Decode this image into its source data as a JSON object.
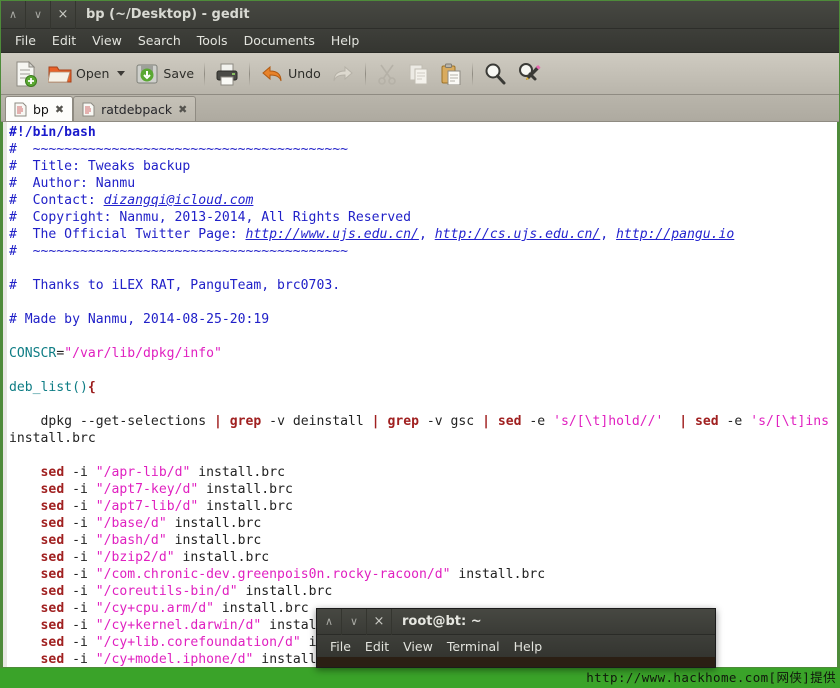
{
  "window": {
    "title": "bp (~/Desktop) - gedit",
    "controls": [
      {
        "name": "minimize",
        "glyph": "∧"
      },
      {
        "name": "maximize",
        "glyph": "∨"
      },
      {
        "name": "close",
        "glyph": "×"
      }
    ]
  },
  "menubar": {
    "items": [
      "File",
      "Edit",
      "View",
      "Search",
      "Tools",
      "Documents",
      "Help"
    ]
  },
  "toolbar": {
    "new_label": "",
    "open_label": "Open",
    "save_label": "Save",
    "print_label": "",
    "undo_label": "Undo",
    "redo_label": "",
    "cut_label": "",
    "copy_label": "",
    "paste_label": "",
    "find_label": "",
    "replace_label": ""
  },
  "tabs": [
    {
      "label": "bp",
      "active": true,
      "close": "✖"
    },
    {
      "label": "ratdebpack",
      "active": false,
      "close": "✖"
    }
  ],
  "editor": {
    "lines": [
      {
        "t": "shebang",
        "text": "#!/bin/bash"
      },
      {
        "t": "comment",
        "text": "#  ~~~~~~~~~~~~~~~~~~~~~~~~~~~~~~~~~~~~~~~~"
      },
      {
        "t": "comment",
        "text": "#  Title: Tweaks backup"
      },
      {
        "t": "comment",
        "text": "#  Author: Nanmu"
      },
      {
        "t": "comment_link",
        "pre": "#  Contact: ",
        "links": [
          "dizangqi@icloud.com"
        ],
        "seps": []
      },
      {
        "t": "comment",
        "text": "#  Copyright: Nanmu, 2013-2014, All Rights Reserved"
      },
      {
        "t": "comment_link",
        "pre": "#  The Official Twitter Page: ",
        "links": [
          "http://www.ujs.edu.cn/",
          "http://cs.ujs.edu.cn/",
          "http://pangu.io"
        ],
        "seps": [
          ", ",
          ", "
        ]
      },
      {
        "t": "comment",
        "text": "#  ~~~~~~~~~~~~~~~~~~~~~~~~~~~~~~~~~~~~~~~~"
      },
      {
        "t": "blank",
        "text": ""
      },
      {
        "t": "comment",
        "text": "#  Thanks to iLEX RAT, PanguTeam, brc0703."
      },
      {
        "t": "blank",
        "text": ""
      },
      {
        "t": "comment",
        "text": "# Made by Nanmu, 2014-08-25-20:19"
      },
      {
        "t": "blank",
        "text": ""
      },
      {
        "t": "assign",
        "var": "CONSCR",
        "op": "=",
        "str": "\"/var/lib/dpkg/info\""
      },
      {
        "t": "blank",
        "text": ""
      },
      {
        "t": "func",
        "name": "deb_list()",
        "brace": "{"
      },
      {
        "t": "blank",
        "text": ""
      },
      {
        "t": "pipeline",
        "text": "    dpkg --get-selections | grep -v deinstall | grep -v gsc | sed -e 's/[\\t]hold//'  | sed -e 's/[\\t]ins"
      },
      {
        "t": "plain",
        "text": "install.brc"
      },
      {
        "t": "blank",
        "text": ""
      },
      {
        "t": "sed",
        "indent": "    ",
        "cmd": "sed",
        "flag": " -i ",
        "str": "\"/apr-lib/d\"",
        "tail": " install.brc"
      },
      {
        "t": "sed",
        "indent": "    ",
        "cmd": "sed",
        "flag": " -i ",
        "str": "\"/apt7-key/d\"",
        "tail": " install.brc"
      },
      {
        "t": "sed",
        "indent": "    ",
        "cmd": "sed",
        "flag": " -i ",
        "str": "\"/apt7-lib/d\"",
        "tail": " install.brc"
      },
      {
        "t": "sed",
        "indent": "    ",
        "cmd": "sed",
        "flag": " -i ",
        "str": "\"/base/d\"",
        "tail": " install.brc"
      },
      {
        "t": "sed",
        "indent": "    ",
        "cmd": "sed",
        "flag": " -i ",
        "str": "\"/bash/d\"",
        "tail": " install.brc"
      },
      {
        "t": "sed",
        "indent": "    ",
        "cmd": "sed",
        "flag": " -i ",
        "str": "\"/bzip2/d\"",
        "tail": " install.brc"
      },
      {
        "t": "sed",
        "indent": "    ",
        "cmd": "sed",
        "flag": " -i ",
        "str": "\"/com.chronic-dev.greenpois0n.rocky-racoon/d\"",
        "tail": " install.brc"
      },
      {
        "t": "sed",
        "indent": "    ",
        "cmd": "sed",
        "flag": " -i ",
        "str": "\"/coreutils-bin/d\"",
        "tail": " install.brc"
      },
      {
        "t": "sed",
        "indent": "    ",
        "cmd": "sed",
        "flag": " -i ",
        "str": "\"/cy+cpu.arm/d\"",
        "tail": " install.brc"
      },
      {
        "t": "sed",
        "indent": "    ",
        "cmd": "sed",
        "flag": " -i ",
        "str": "\"/cy+kernel.darwin/d\"",
        "tail": " install.brc"
      },
      {
        "t": "sed",
        "indent": "    ",
        "cmd": "sed",
        "flag": " -i ",
        "str": "\"/cy+lib.corefoundation/d\"",
        "tail": " install.brc"
      },
      {
        "t": "sed",
        "indent": "    ",
        "cmd": "sed",
        "flag": " -i ",
        "str": "\"/cy+model.iphone/d\"",
        "tail": " install.brc"
      }
    ]
  },
  "terminal": {
    "title": "root@bt: ~",
    "controls": [
      {
        "name": "minimize",
        "glyph": "∧"
      },
      {
        "name": "maximize",
        "glyph": "∨"
      },
      {
        "name": "close",
        "glyph": "×"
      }
    ],
    "menubar": {
      "items": [
        "File",
        "Edit",
        "View",
        "Terminal",
        "Help"
      ]
    }
  },
  "watermark": {
    "text": "http://www.hackhome.com[网侠]提供"
  },
  "colors": {
    "comment": "#2020c8",
    "string": "#e020c0",
    "keyword": "#a02020",
    "variable": "#0d7c84",
    "editor_border": "#4e8b3a",
    "desktop": "#3aa329",
    "titlebar": "#3c3d38"
  }
}
